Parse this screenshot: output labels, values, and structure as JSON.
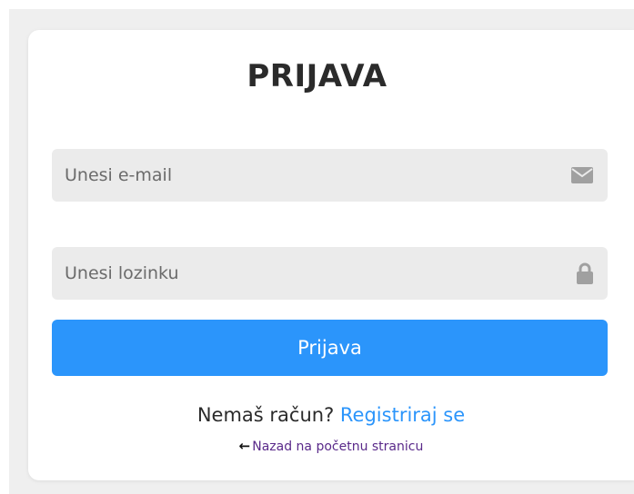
{
  "login": {
    "title": "PRIJAVA",
    "email": {
      "placeholder": "Unesi e-mail",
      "value": "",
      "icon": "envelope-icon"
    },
    "password": {
      "placeholder": "Unesi lozinku",
      "value": "",
      "icon": "lock-icon"
    },
    "submit_label": "Prijava",
    "register_prompt": "Nemaš račun? ",
    "register_link": "Registriraj se",
    "back_arrow": "←",
    "back_link": "Nazad na početnu stranicu"
  },
  "colors": {
    "page_background": "#efefef",
    "card_background": "#ffffff",
    "field_background": "#ebebeb",
    "primary": "#2b95fb",
    "link": "#2b95fb",
    "back_link": "#5a2a8a",
    "title_text": "#2b2b2b",
    "icon": "#a0a0a0"
  }
}
